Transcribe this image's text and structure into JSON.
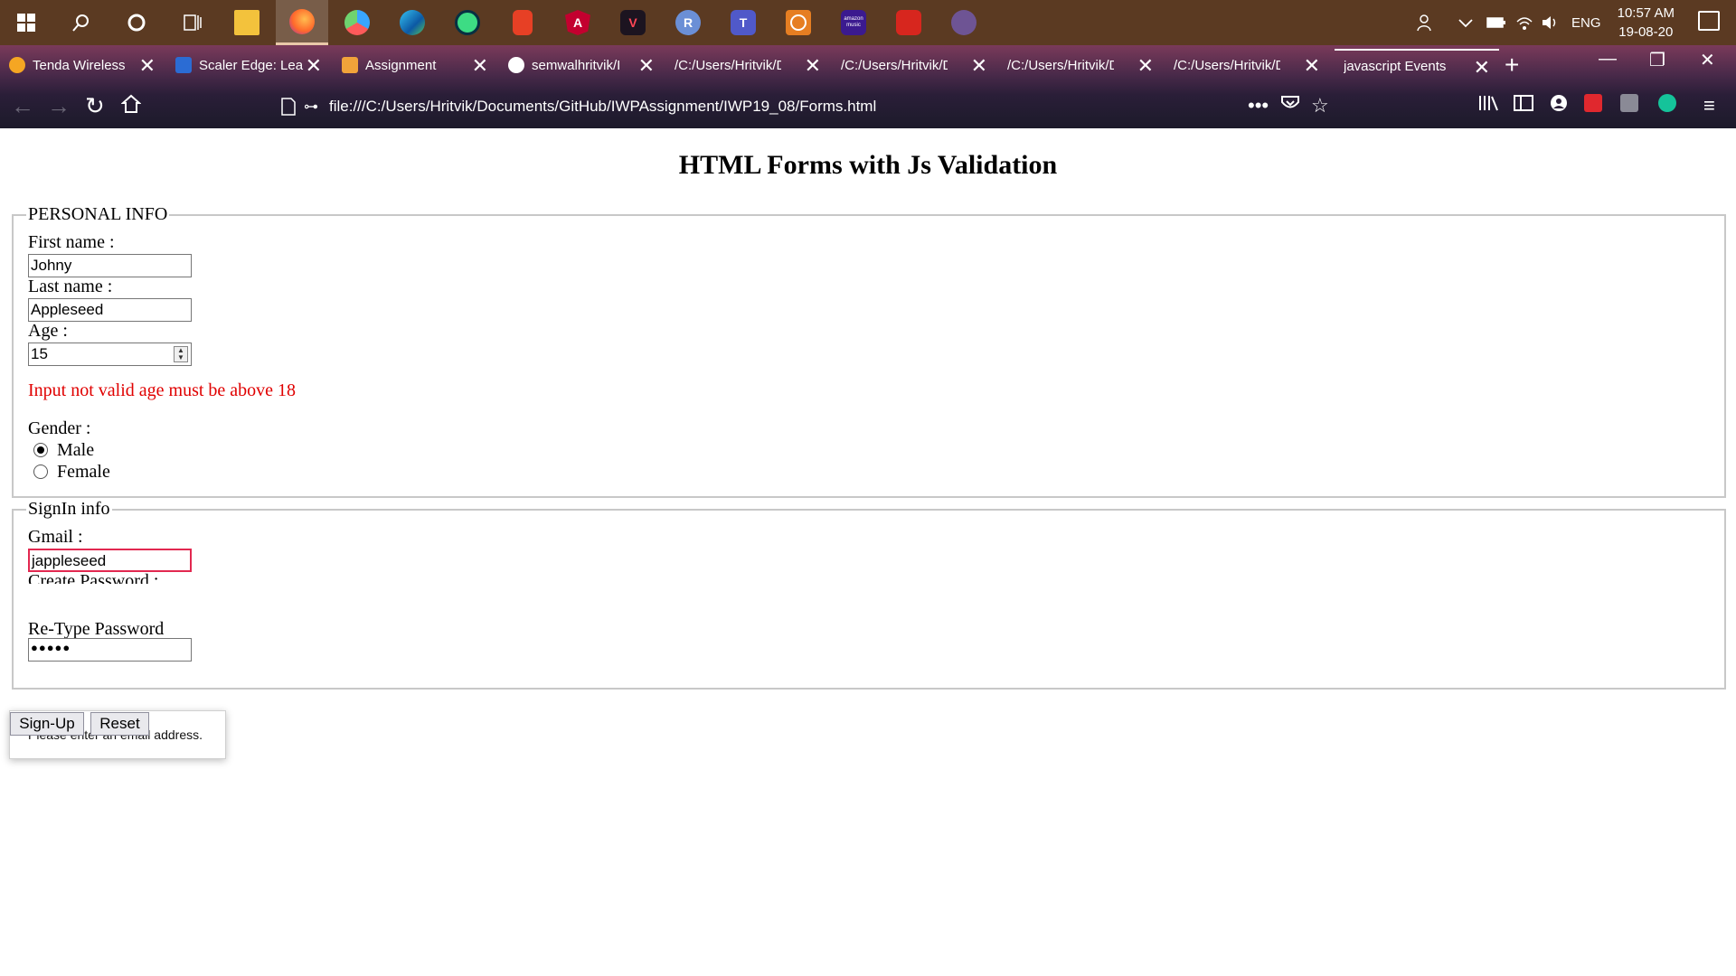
{
  "taskbar": {
    "apps": [
      "windows-icon",
      "search-icon",
      "cortana-icon",
      "task-view-icon",
      "file-explorer-icon",
      "firefox-icon",
      "davinci-icon",
      "edge-icon",
      "android-studio-icon",
      "office-icon",
      "angular-icon",
      "valorant-icon",
      "r-icon",
      "teams-icon",
      "whatsapp-icon",
      "amazon-music-icon",
      "acrobat-icon",
      "github-icon"
    ],
    "r_letter": "R",
    "amazon_label": "amazon music",
    "language": "ENG",
    "time": "10:57 AM",
    "date": "19-08-20"
  },
  "tabs": [
    {
      "title": "Tenda Wireless",
      "color": "#f5a623"
    },
    {
      "title": "Scaler Edge: Lea",
      "color": "#2b6cd4"
    },
    {
      "title": "Assignment",
      "color": "#f1a33a"
    },
    {
      "title": "semwalhritvik/I",
      "color": "#ffffff"
    },
    {
      "title": "/C:/Users/Hritvik/Dc",
      "color": ""
    },
    {
      "title": "/C:/Users/Hritvik/Do",
      "color": ""
    },
    {
      "title": "/C:/Users/Hritvik/Dc",
      "color": ""
    },
    {
      "title": "/C:/Users/Hritvik/Do",
      "color": ""
    },
    {
      "title": "javascript Events",
      "color": ""
    }
  ],
  "url": "file:///C:/Users/Hritvik/Documents/GitHub/IWPAssignment/IWP19_08/Forms.html",
  "page": {
    "title": "HTML Forms with Js Validation",
    "personal": {
      "legend": "PERSONAL INFO",
      "first_name_label": "First name :",
      "first_name_value": "Johny",
      "last_name_label": "Last name :",
      "last_name_value": "Appleseed",
      "age_label": "Age :",
      "age_value": "15",
      "error": "Input not valid age must be above 18",
      "gender_label": "Gender :",
      "male": "Male",
      "female": "Female"
    },
    "signin": {
      "legend": "SignIn info",
      "gmail_label": "Gmail :",
      "gmail_value": "jappleseed",
      "create_password_label": "Create Password :",
      "retype_label": "Re-Type Password",
      "retype_value": "●●●●●"
    },
    "tooltip": "Please enter an email address.",
    "signup_button": "Sign-Up",
    "reset_button": "Reset"
  }
}
